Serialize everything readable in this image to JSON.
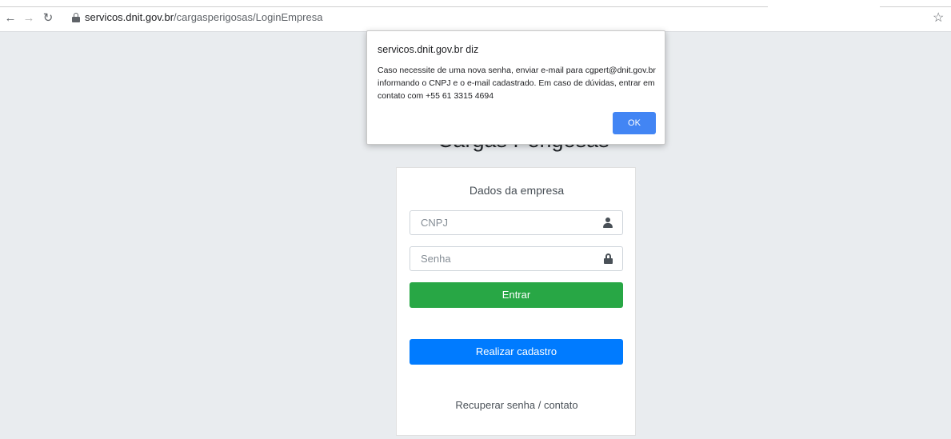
{
  "browser": {
    "url_host": "servicos.dnit.gov.br",
    "url_path": "/cargasperigosas/LoginEmpresa",
    "icons": [
      "back-arrow-icon",
      "forward-arrow-icon",
      "reload-icon",
      "lock-icon",
      "star-icon"
    ]
  },
  "page": {
    "heading": "Cargas Perigosas",
    "card_title": "Dados da empresa",
    "cnpj_placeholder": "CNPJ",
    "senha_placeholder": "Senha",
    "entrar_label": "Entrar",
    "cadastro_label": "Realizar cadastro",
    "recover_label": "Recuperar senha / contato",
    "colors": {
      "entrar": "#28a745",
      "cadastro": "#007bff",
      "background": "#e9ecef"
    }
  },
  "dialog": {
    "title": "servicos.dnit.gov.br diz",
    "message": "Caso necessite de uma nova senha, enviar e-mail para cgpert@dnit.gov.br informando o CNPJ e o e-mail cadastrado. Em caso de dúvidas, entrar em contato com +55 61 3315 4694",
    "ok_label": "OK",
    "ok_color": "#4285f4"
  }
}
